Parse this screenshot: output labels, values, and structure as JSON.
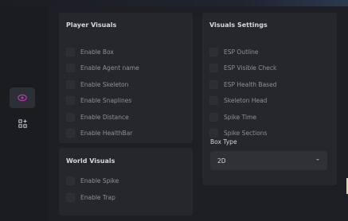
{
  "sidebar": {
    "items": [
      {
        "icon": "eye-icon",
        "active": true,
        "color": "#b23aa6"
      },
      {
        "icon": "add-module-icon",
        "active": false,
        "color": "#c8c9cc"
      }
    ]
  },
  "player_visuals": {
    "title": "Player Visuals",
    "options": [
      {
        "label": "Enable Box",
        "checked": false
      },
      {
        "label": "Enable Agent name",
        "checked": false
      },
      {
        "label": "Enable Skeleton",
        "checked": false
      },
      {
        "label": "Enable Snaplines",
        "checked": false
      },
      {
        "label": "Enable Distance",
        "checked": false
      },
      {
        "label": "Enable HealthBar",
        "checked": false
      }
    ]
  },
  "world_visuals": {
    "title": "World Visuals",
    "options": [
      {
        "label": "Enable Spike",
        "checked": false
      },
      {
        "label": "Enable Trap",
        "checked": false
      }
    ]
  },
  "visuals_settings": {
    "title": "Visuals Settings",
    "options": [
      {
        "label": "ESP Outline",
        "checked": false
      },
      {
        "label": "ESP Visible Check",
        "checked": false
      },
      {
        "label": "ESP Health Based",
        "checked": false
      },
      {
        "label": "Skeleton Head",
        "checked": false
      },
      {
        "label": "Spike Time",
        "checked": false
      },
      {
        "label": "Spike Sections",
        "checked": false
      }
    ],
    "box_type": {
      "label": "Box Type",
      "value": "2D"
    }
  }
}
